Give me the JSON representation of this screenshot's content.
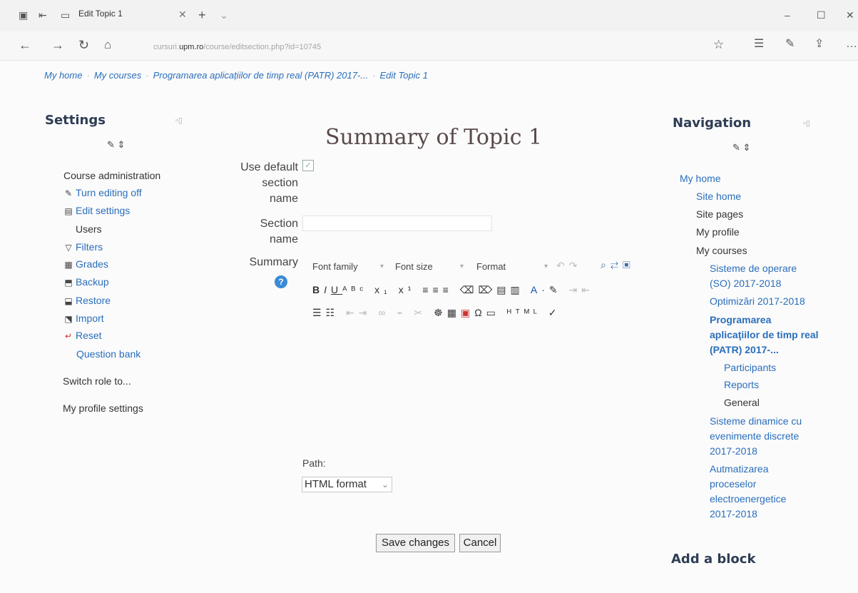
{
  "browser": {
    "tab_title": "Edit Topic 1",
    "url_host": "upm.ro",
    "url_prefix": "cursuri.",
    "url_suffix": "/course/editsection.php?id=10745"
  },
  "breadcrumb": [
    "My home",
    "My courses",
    "Programarea aplicațiilor de timp real (PATR) 2017-...",
    "Edit Topic 1"
  ],
  "settings": {
    "heading": "Settings",
    "items": [
      {
        "label": "Course administration",
        "link": false
      },
      {
        "label": "Turn editing off",
        "link": true,
        "icon": "pencil-icon"
      },
      {
        "label": "Edit settings",
        "link": true,
        "icon": "document-icon"
      },
      {
        "label": "Users",
        "link": false
      },
      {
        "label": "Filters",
        "link": true,
        "icon": "funnel-icon"
      },
      {
        "label": "Grades",
        "link": true,
        "icon": "table-icon"
      },
      {
        "label": "Backup",
        "link": true,
        "icon": "backup-icon"
      },
      {
        "label": "Restore",
        "link": true,
        "icon": "restore-icon"
      },
      {
        "label": "Import",
        "link": true,
        "icon": "import-icon"
      },
      {
        "label": "Reset",
        "link": true,
        "icon": "reset-icon"
      },
      {
        "label": "Question bank",
        "link": true
      },
      {
        "label": "Switch role to...",
        "link": false
      },
      {
        "label": "My profile settings",
        "link": false
      }
    ]
  },
  "main": {
    "title": "Summary of Topic 1",
    "use_default_label": [
      "Use default",
      "section",
      "name"
    ],
    "use_default_checked": true,
    "section_name_label": [
      "Section",
      "name"
    ],
    "section_name_value": "",
    "summary_label": "Summary",
    "editor": {
      "font_family": "Font family",
      "font_size": "Font size",
      "format": "Format"
    },
    "path_label": "Path:",
    "format_select": "HTML format",
    "save_label": "Save changes",
    "cancel_label": "Cancel"
  },
  "navigation": {
    "heading": "Navigation",
    "items": [
      {
        "label": "My home",
        "level": 0,
        "link": true
      },
      {
        "label": "Site home",
        "level": 1,
        "link": true
      },
      {
        "label": "Site pages",
        "level": 1,
        "link": false
      },
      {
        "label": "My profile",
        "level": 1,
        "link": false
      },
      {
        "label": "My courses",
        "level": 1,
        "link": false
      },
      {
        "label": "Sisteme de operare (SO) 2017-2018",
        "level": 2,
        "link": true
      },
      {
        "label": "Optimizări 2017-2018",
        "level": 2,
        "link": true
      },
      {
        "label": "Programarea aplicaţiilor de timp real (PATR) 2017-...",
        "level": 2,
        "link": true,
        "bold": true
      },
      {
        "label": "Participants",
        "level": 3,
        "link": true
      },
      {
        "label": "Reports",
        "level": 3,
        "link": true
      },
      {
        "label": "General",
        "level": 3,
        "link": false
      },
      {
        "label": "Sisteme dinamice cu evenimente discrete 2017-2018",
        "level": 2,
        "link": true
      },
      {
        "label": "Autmatizarea proceselor electroenergetice 2017-2018",
        "level": 2,
        "link": true
      }
    ],
    "add_block": "Add a block"
  },
  "colors": {
    "link": "#2a6ebb",
    "heading": "#2d3d54"
  }
}
